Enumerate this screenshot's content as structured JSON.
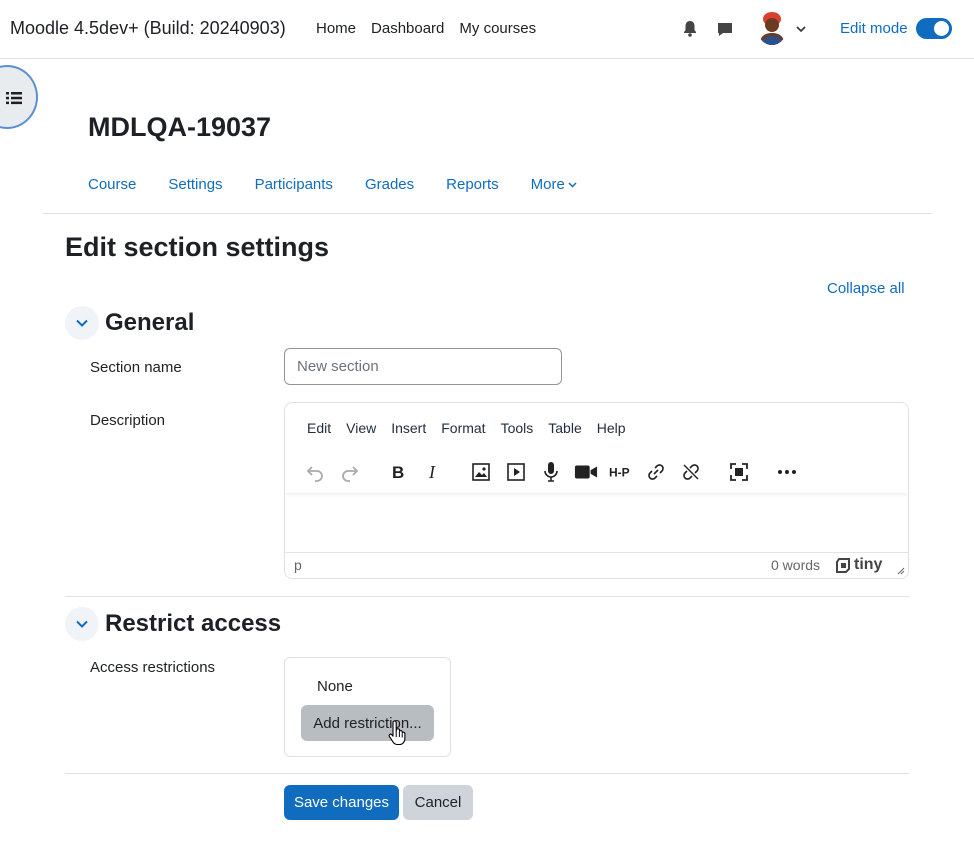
{
  "navbar": {
    "brand": "Moodle 4.5dev+ (Build: 20240903)",
    "links": [
      "Home",
      "Dashboard",
      "My courses"
    ],
    "edit_mode_label": "Edit mode",
    "edit_mode_on": true
  },
  "course": {
    "title": "MDLQA-19037",
    "nav": [
      "Course",
      "Settings",
      "Participants",
      "Grades",
      "Reports"
    ],
    "more_label": "More"
  },
  "page": {
    "title": "Edit section settings",
    "collapse_all": "Collapse all"
  },
  "general": {
    "heading": "General",
    "section_name_label": "Section name",
    "section_name_placeholder": "New section",
    "description_label": "Description"
  },
  "editor": {
    "menus": [
      "Edit",
      "View",
      "Insert",
      "Format",
      "Tools",
      "Table",
      "Help"
    ],
    "path": "p",
    "word_count": "0 words",
    "brand": "tiny"
  },
  "restrict": {
    "heading": "Restrict access",
    "label": "Access restrictions",
    "none_text": "None",
    "add_button": "Add restriction..."
  },
  "actions": {
    "save": "Save changes",
    "cancel": "Cancel"
  },
  "colors": {
    "primary": "#0f6cbf",
    "secondary_button": "#ced4da"
  }
}
